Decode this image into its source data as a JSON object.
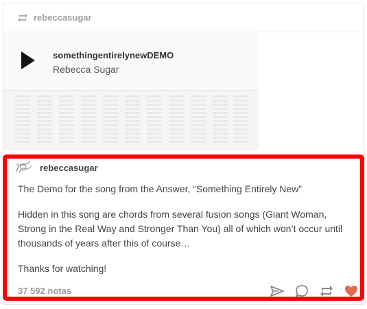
{
  "reblog_header": {
    "username": "rebeccasugar",
    "icon": "reblog-icon"
  },
  "audio_player": {
    "track_title": "somethingentirelynewDEMO",
    "artist": "Rebecca Sugar",
    "play_icon": "play-icon"
  },
  "post": {
    "author": "rebeccasugar",
    "paragraphs": [
      "The Demo for the song from the Answer, “Something Entirely New”",
      "Hidden in this song are chords from several fusion songs (Giant Woman, Strong in the Real Way and Stronger Than You) all of which won’t occur until thousands of years after this of course…",
      "Thanks for watching!"
    ],
    "notes": "37 592 notas",
    "actions": [
      "share-icon",
      "reply-icon",
      "reblog-icon",
      "like-icon"
    ]
  },
  "colors": {
    "highlight": "#ff0000",
    "like": "#e06a4e",
    "muted": "#a0a0a0"
  }
}
